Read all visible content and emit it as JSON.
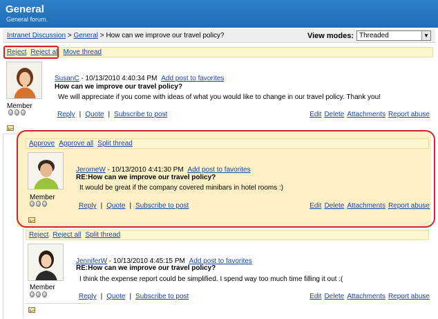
{
  "forum": {
    "title": "General",
    "subtitle": "General forum."
  },
  "breadcrumb": {
    "root": "Intranet Discussion",
    "sep1": " > ",
    "forum": "General",
    "sep2": " > ",
    "current": "How can we improve our travel policy?"
  },
  "view_modes": {
    "label": "View modes:",
    "selected": "Threaded"
  },
  "posts": [
    {
      "actions": [
        "Reject",
        "Reject all",
        "Move thread"
      ],
      "author": "SusanC",
      "date": " - 10/13/2010 4:40:34 PM ",
      "favorites": "Add post to favorites",
      "subject": "How can we improve our travel policy?",
      "text": "We will appreciate if you come with ideas of what you would like to change in our travel policy. Thank you!",
      "member": "Member",
      "reply": "Reply",
      "quote": "Quote",
      "subscribe": "Subscribe to post",
      "edit": "Edit",
      "delete": "Delete",
      "attachments": "Attachments",
      "report": "Report abuse"
    },
    {
      "actions": [
        "Approve",
        "Approve all",
        "Split thread"
      ],
      "author": "JeromeW",
      "date": " - 10/13/2010 4:41:30 PM ",
      "favorites": "Add post to favorites",
      "subject": "RE:How can we improve our travel policy?",
      "text": "It would be great if the company covered minibars in hotel rooms :)",
      "member": "Member",
      "reply": "Reply",
      "quote": "Quote",
      "subscribe": "Subscribe to post",
      "edit": "Edit",
      "delete": "Delete",
      "attachments": "Attachments",
      "report": "Report abuse"
    },
    {
      "actions": [
        "Reject",
        "Reject all",
        "Split thread"
      ],
      "author": "JenniferW",
      "date": " - 10/13/2010 4:45:15 PM ",
      "favorites": "Add post to favorites",
      "subject": "RE:How can we improve our travel policy?",
      "text": "I think the expense report could be simplified. I spend way too much time filling it out :(",
      "member": "Member",
      "reply": "Reply",
      "quote": "Quote",
      "subscribe": "Subscribe to post",
      "edit": "Edit",
      "delete": "Delete",
      "attachments": "Attachments",
      "report": "Report abuse"
    }
  ],
  "separator": "|"
}
